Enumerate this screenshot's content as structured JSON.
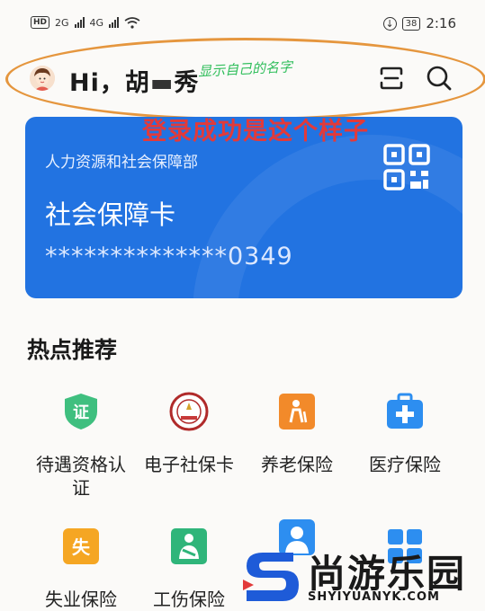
{
  "status_bar": {
    "hd": "HD",
    "sim1": "2G",
    "sim2": "4G",
    "battery": "38",
    "time": "2:16"
  },
  "header": {
    "greeting": "Hi，胡",
    "greeting_tail": "秀",
    "annotation_name": "显示自己的名字",
    "annotation_login": "登录成功是这个样子",
    "accent_color": "#e5963e"
  },
  "card": {
    "ministry": "人力资源和社会保障部",
    "title": "社会保障卡",
    "number": "**************0349",
    "color": "#2273e1"
  },
  "hot": {
    "title": "热点推荐",
    "items": [
      {
        "label": "待遇资格认",
        "label2": "证",
        "icon": "certificate-shield-icon"
      },
      {
        "label": "电子社保卡",
        "label2": "",
        "icon": "social-security-seal-icon"
      },
      {
        "label": "养老保险",
        "label2": "",
        "icon": "elderly-icon"
      },
      {
        "label": "医疗保险",
        "label2": "",
        "icon": "medical-kit-icon"
      },
      {
        "label": "失业保险",
        "label2": "",
        "icon": "unemployment-icon"
      },
      {
        "label": "工伤保险",
        "label2": "",
        "icon": "work-injury-icon"
      },
      {
        "label": "",
        "label2": "",
        "icon": "person-card-icon"
      },
      {
        "label": "",
        "label2": "",
        "icon": "apps-grid-icon"
      }
    ]
  },
  "watermark": {
    "name": "尚游乐园",
    "domain": "SHYIYUANYK.COM"
  }
}
